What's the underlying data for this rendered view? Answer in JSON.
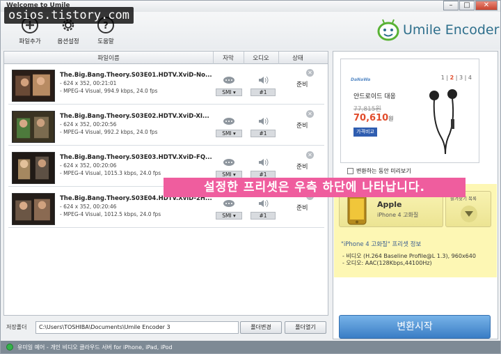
{
  "window": {
    "title": "Welcome to Umile",
    "buttons": [
      "–",
      "□",
      "✕"
    ]
  },
  "watermark": "osios.tistory.com",
  "toolbar": {
    "add_file": "파일추가",
    "settings": "옵션설정",
    "help": "도움말"
  },
  "logo": {
    "text": "Umile Encoder"
  },
  "list": {
    "headers": {
      "filename": "파일이름",
      "subtitle": "자막",
      "audio": "오디오",
      "status": "상태"
    },
    "rows": [
      {
        "name": "The.Big.Bang.Theory.S03E01.HDTV.XviD-No...",
        "res": "- 624 x 352, 00:21:01",
        "codec": "- MPEG-4 Visual, 994.9 kbps, 24.0 fps",
        "subtitle": "SMI ▾",
        "audio": "#1",
        "status": "준비"
      },
      {
        "name": "The.Big.Bang.Theory.S03E02.HDTV.XviD-XI...",
        "res": "- 624 x 352, 00:20:56",
        "codec": "- MPEG-4 Visual, 992.2 kbps, 24.0 fps",
        "subtitle": "SMI ▾",
        "audio": "#1",
        "status": "준비"
      },
      {
        "name": "The.Big.Bang.Theory.S03E03.HDTV.XviD-FQ...",
        "res": "- 624 x 352, 00:20:06",
        "codec": "- MPEG-4 Visual, 1015.3 kbps, 24.0 fps",
        "subtitle": "SMI ▾",
        "audio": "#1",
        "status": "준비"
      },
      {
        "name": "The.Big.Bang.Theory.S03E04.HDTV.XviD-2H...",
        "res": "- 624 x 352, 00:20:46",
        "codec": "- MPEG-4 Visual, 1012.5 kbps, 24.0 fps",
        "subtitle": "SMI ▾",
        "audio": "#1",
        "status": "준비"
      }
    ]
  },
  "save": {
    "label": "저장폴더",
    "path": "C:\\Users\\TOSHIBA\\Documents\\Umile Encoder 3",
    "change_btn": "폴더변경",
    "open_btn": "폴더열기"
  },
  "ad": {
    "brand": "DaNaWa",
    "pager": [
      "1",
      "2",
      "3",
      "4"
    ],
    "pager_sep": "|",
    "pager_current": "2",
    "title": "안드로이드 대응",
    "old_price": "77,815원",
    "new_price": "70,610",
    "new_price_unit": "원",
    "compare": "가격비교"
  },
  "preview": {
    "label": "변환하는 동안 미리보기"
  },
  "caption": "설정한 프리셋은 우측 하단에 나타납니다.",
  "preset": {
    "name": "Apple",
    "sub": "iPhone 4 고화질",
    "favorites": "즐겨찾기 목록",
    "info_title": "\"iPhone 4 고화질\" 프리셋 정보",
    "video": "- 비디오 (H.264 Baseline Profile@L 1.3), 960x640",
    "audio": "- 오디오: AAC(128Kbps,44100Hz)"
  },
  "convert": {
    "label": "변환시작"
  },
  "statusbar": {
    "text": "유미일 예어 - 개인 비디오 클라우드 서버 for iPhone, iPad, iPod"
  },
  "colors": {
    "accent": "#3a7dc5",
    "highlight": "#fdf7b4",
    "caption": "#ef5d9e",
    "price": "#e14c2b"
  }
}
